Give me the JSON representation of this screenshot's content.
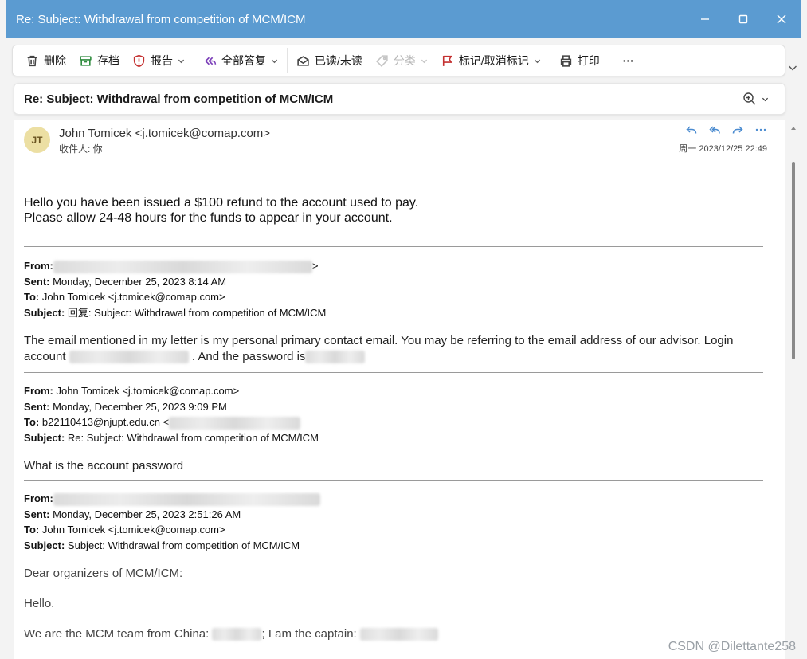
{
  "window": {
    "title": "Re: Subject: Withdrawal from competition of MCM/ICM"
  },
  "toolbar": {
    "delete_label": "删除",
    "archive_label": "存档",
    "report_label": "报告",
    "reply_all_label": "全部答复",
    "read_unread_label": "已读/未读",
    "categorize_label": "分类",
    "flag_label": "标记/取消标记",
    "print_label": "打印",
    "more_label": "···"
  },
  "subject_bar": {
    "subject": "Re: Subject: Withdrawal from competition of MCM/ICM"
  },
  "message": {
    "avatar_initials": "JT",
    "sender": "John Tomicek <j.tomicek@comap.com>",
    "recipient": "收件人: 你",
    "datetime": "周一 2023/12/25 22:49",
    "body_line1": "Hello you have been issued a $100 refund to the account used to pay.",
    "body_line2": "Please allow 24-48 hours for the funds to appear in your account."
  },
  "quoted1": {
    "from_label": "From:",
    "from_tail": ">",
    "sent_label": "Sent:",
    "sent_value": "Monday, December 25, 2023 8:14 AM",
    "to_label": "To:",
    "to_value": "John Tomicek <j.tomicek@comap.com>",
    "subject_label": "Subject:",
    "subject_value": "回复: Subject: Withdrawal from competition of MCM/ICM",
    "body_line1": "The email mentioned in my letter is my personal primary contact email. You may be referring to the email address of our advisor. Login",
    "body_pre": "account",
    "body_mid": ". And the password is"
  },
  "quoted2": {
    "from_label": "From:",
    "from_value": "John Tomicek <j.tomicek@comap.com>",
    "sent_label": "Sent:",
    "sent_value": "Monday, December 25, 2023 9:09 PM",
    "to_label": "To:",
    "to_value": "b22110413@njupt.edu.cn <",
    "subject_label": "Subject:",
    "subject_value": "Re: Subject: Withdrawal from competition of MCM/ICM",
    "body": "What is the account password"
  },
  "quoted3": {
    "from_label": "From:",
    "sent_label": "Sent:",
    "sent_value": "Monday, December 25, 2023 2:51:26 AM",
    "to_label": "To:",
    "to_value": "John Tomicek <j.tomicek@comap.com>",
    "subject_label": "Subject:",
    "subject_value": "Subject: Withdrawal from competition of MCM/ICM",
    "greeting": "Dear organizers of MCM/ICM:",
    "hello": "Hello.",
    "team_pre": "We are the MCM team from China:",
    "team_mid": "; I am the captain:"
  },
  "watermark": "CSDN @Dilettante258"
}
